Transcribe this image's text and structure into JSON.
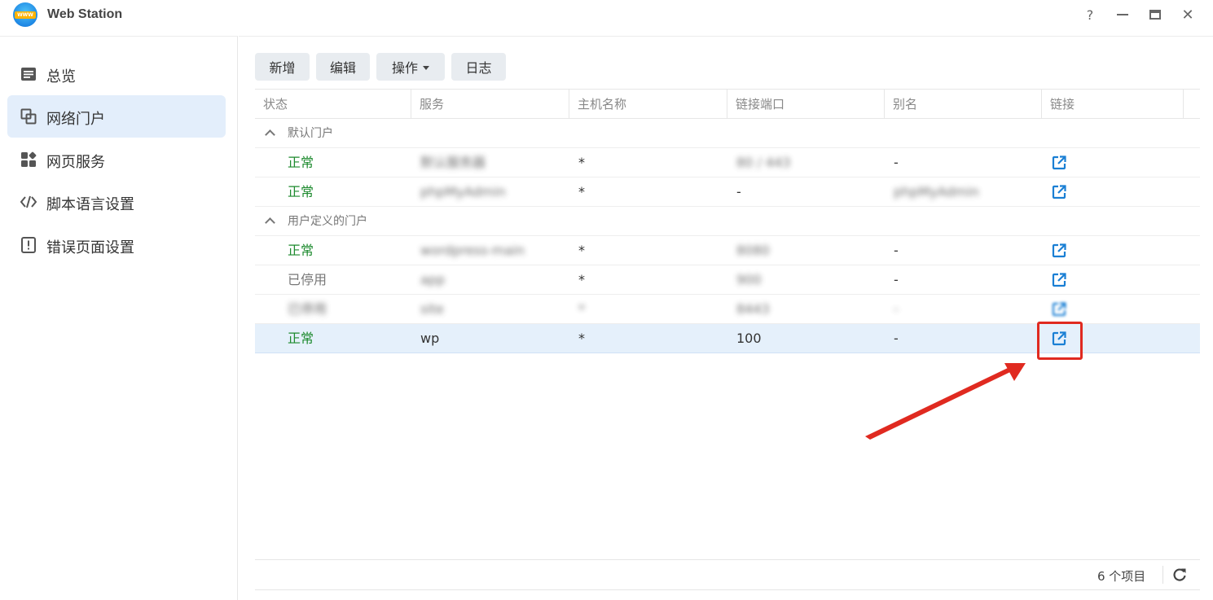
{
  "window": {
    "title": "Web Station",
    "icon_text": "WWW",
    "controls": {
      "help": "?",
      "close": "✕"
    }
  },
  "sidebar": {
    "items": [
      {
        "label": "总览",
        "icon": "overview-icon"
      },
      {
        "label": "网络门户",
        "icon": "portal-icon",
        "active": true
      },
      {
        "label": "网页服务",
        "icon": "web-service-icon"
      },
      {
        "label": "脚本语言设置",
        "icon": "code-icon"
      },
      {
        "label": "错误页面设置",
        "icon": "error-page-icon"
      }
    ]
  },
  "toolbar": {
    "add": "新增",
    "edit": "编辑",
    "actions": "操作",
    "log": "日志"
  },
  "table": {
    "columns": [
      "状态",
      "服务",
      "主机名称",
      "链接端口",
      "别名",
      "链接"
    ],
    "groups": [
      {
        "label": "默认门户"
      },
      {
        "label": "用户定义的门户"
      }
    ],
    "rows": [
      {
        "status": "正常",
        "service": "默认服务器",
        "host": "*",
        "port": "80 / 443",
        "alias": "-"
      },
      {
        "status": "正常",
        "service": "phpMyAdmin",
        "host": "*",
        "port": "-",
        "alias": "phpMyAdmin"
      },
      {
        "status": "正常",
        "service": "wordpress-main",
        "host": "*",
        "port": "8080",
        "alias": "-"
      },
      {
        "status": "已停用",
        "service": "app",
        "host": "*",
        "port": "900",
        "alias": "-"
      },
      {
        "status": "已停用",
        "service": "site",
        "host": "*",
        "port": "8443",
        "alias": "-"
      },
      {
        "status": "正常",
        "service": "wp",
        "host": "*",
        "port": "100",
        "alias": "-"
      }
    ]
  },
  "footer": {
    "count": "6 个项目"
  },
  "colors": {
    "status_ok": "#1d8a2e",
    "accent": "#1a7fd4",
    "highlight": "#e02a20",
    "selected_row": "#e5f0fb"
  }
}
